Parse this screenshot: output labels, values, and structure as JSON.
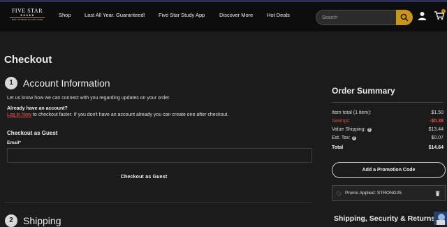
{
  "header": {
    "logo": {
      "title": "FIVE STAR",
      "stars": "★★★★★",
      "tagline": "BUILT STRONG TO LAST LONG"
    },
    "nav": [
      "Shop",
      "Last All Year. Guaranteed!",
      "Five Star Study App",
      "Discover More",
      "Hot Deals"
    ],
    "search": {
      "placeholder": "Search",
      "value": ""
    },
    "cart_count": "1",
    "icons": {
      "search": "search-icon",
      "user": "user-icon",
      "cart": "cart-icon"
    },
    "colors": {
      "accent": "#c99418",
      "bar": "#0d0d0d"
    }
  },
  "checkout": {
    "title": "Checkout",
    "account": {
      "number": "1",
      "title": "Account Information",
      "intro": "Let us know how we can connect with you regarding updates on your order.",
      "have_account": "Already have an account?",
      "login_link": "Log in Now",
      "login_rest": " to checkout faster. If you don't have an account already you can create one after checkout.",
      "guest_heading": "Checkout as Guest",
      "email_label": "Email*",
      "email_value": "",
      "guest_button": "Checkout as Guest"
    },
    "shipping": {
      "number": "2",
      "title": "Shipping"
    }
  },
  "summary": {
    "title": "Order Summary",
    "rows": [
      {
        "label": "Item total (1 item):",
        "value": "$1.50"
      },
      {
        "label": "Savings:",
        "value": "-$0.38"
      },
      {
        "label": "Value Shipping:",
        "value": "$13.44"
      },
      {
        "label": "Est. Tax:",
        "value": "$0.07"
      },
      {
        "label": "Total",
        "value": "$14.64"
      }
    ],
    "info_glyph": "?",
    "promo_button": "Add a Promotion Code",
    "promo_applied": "Promo Applied: STRONG25",
    "shipping_security": "Shipping, Security & Returns",
    "colors": {
      "savings": "#e2544a"
    }
  }
}
